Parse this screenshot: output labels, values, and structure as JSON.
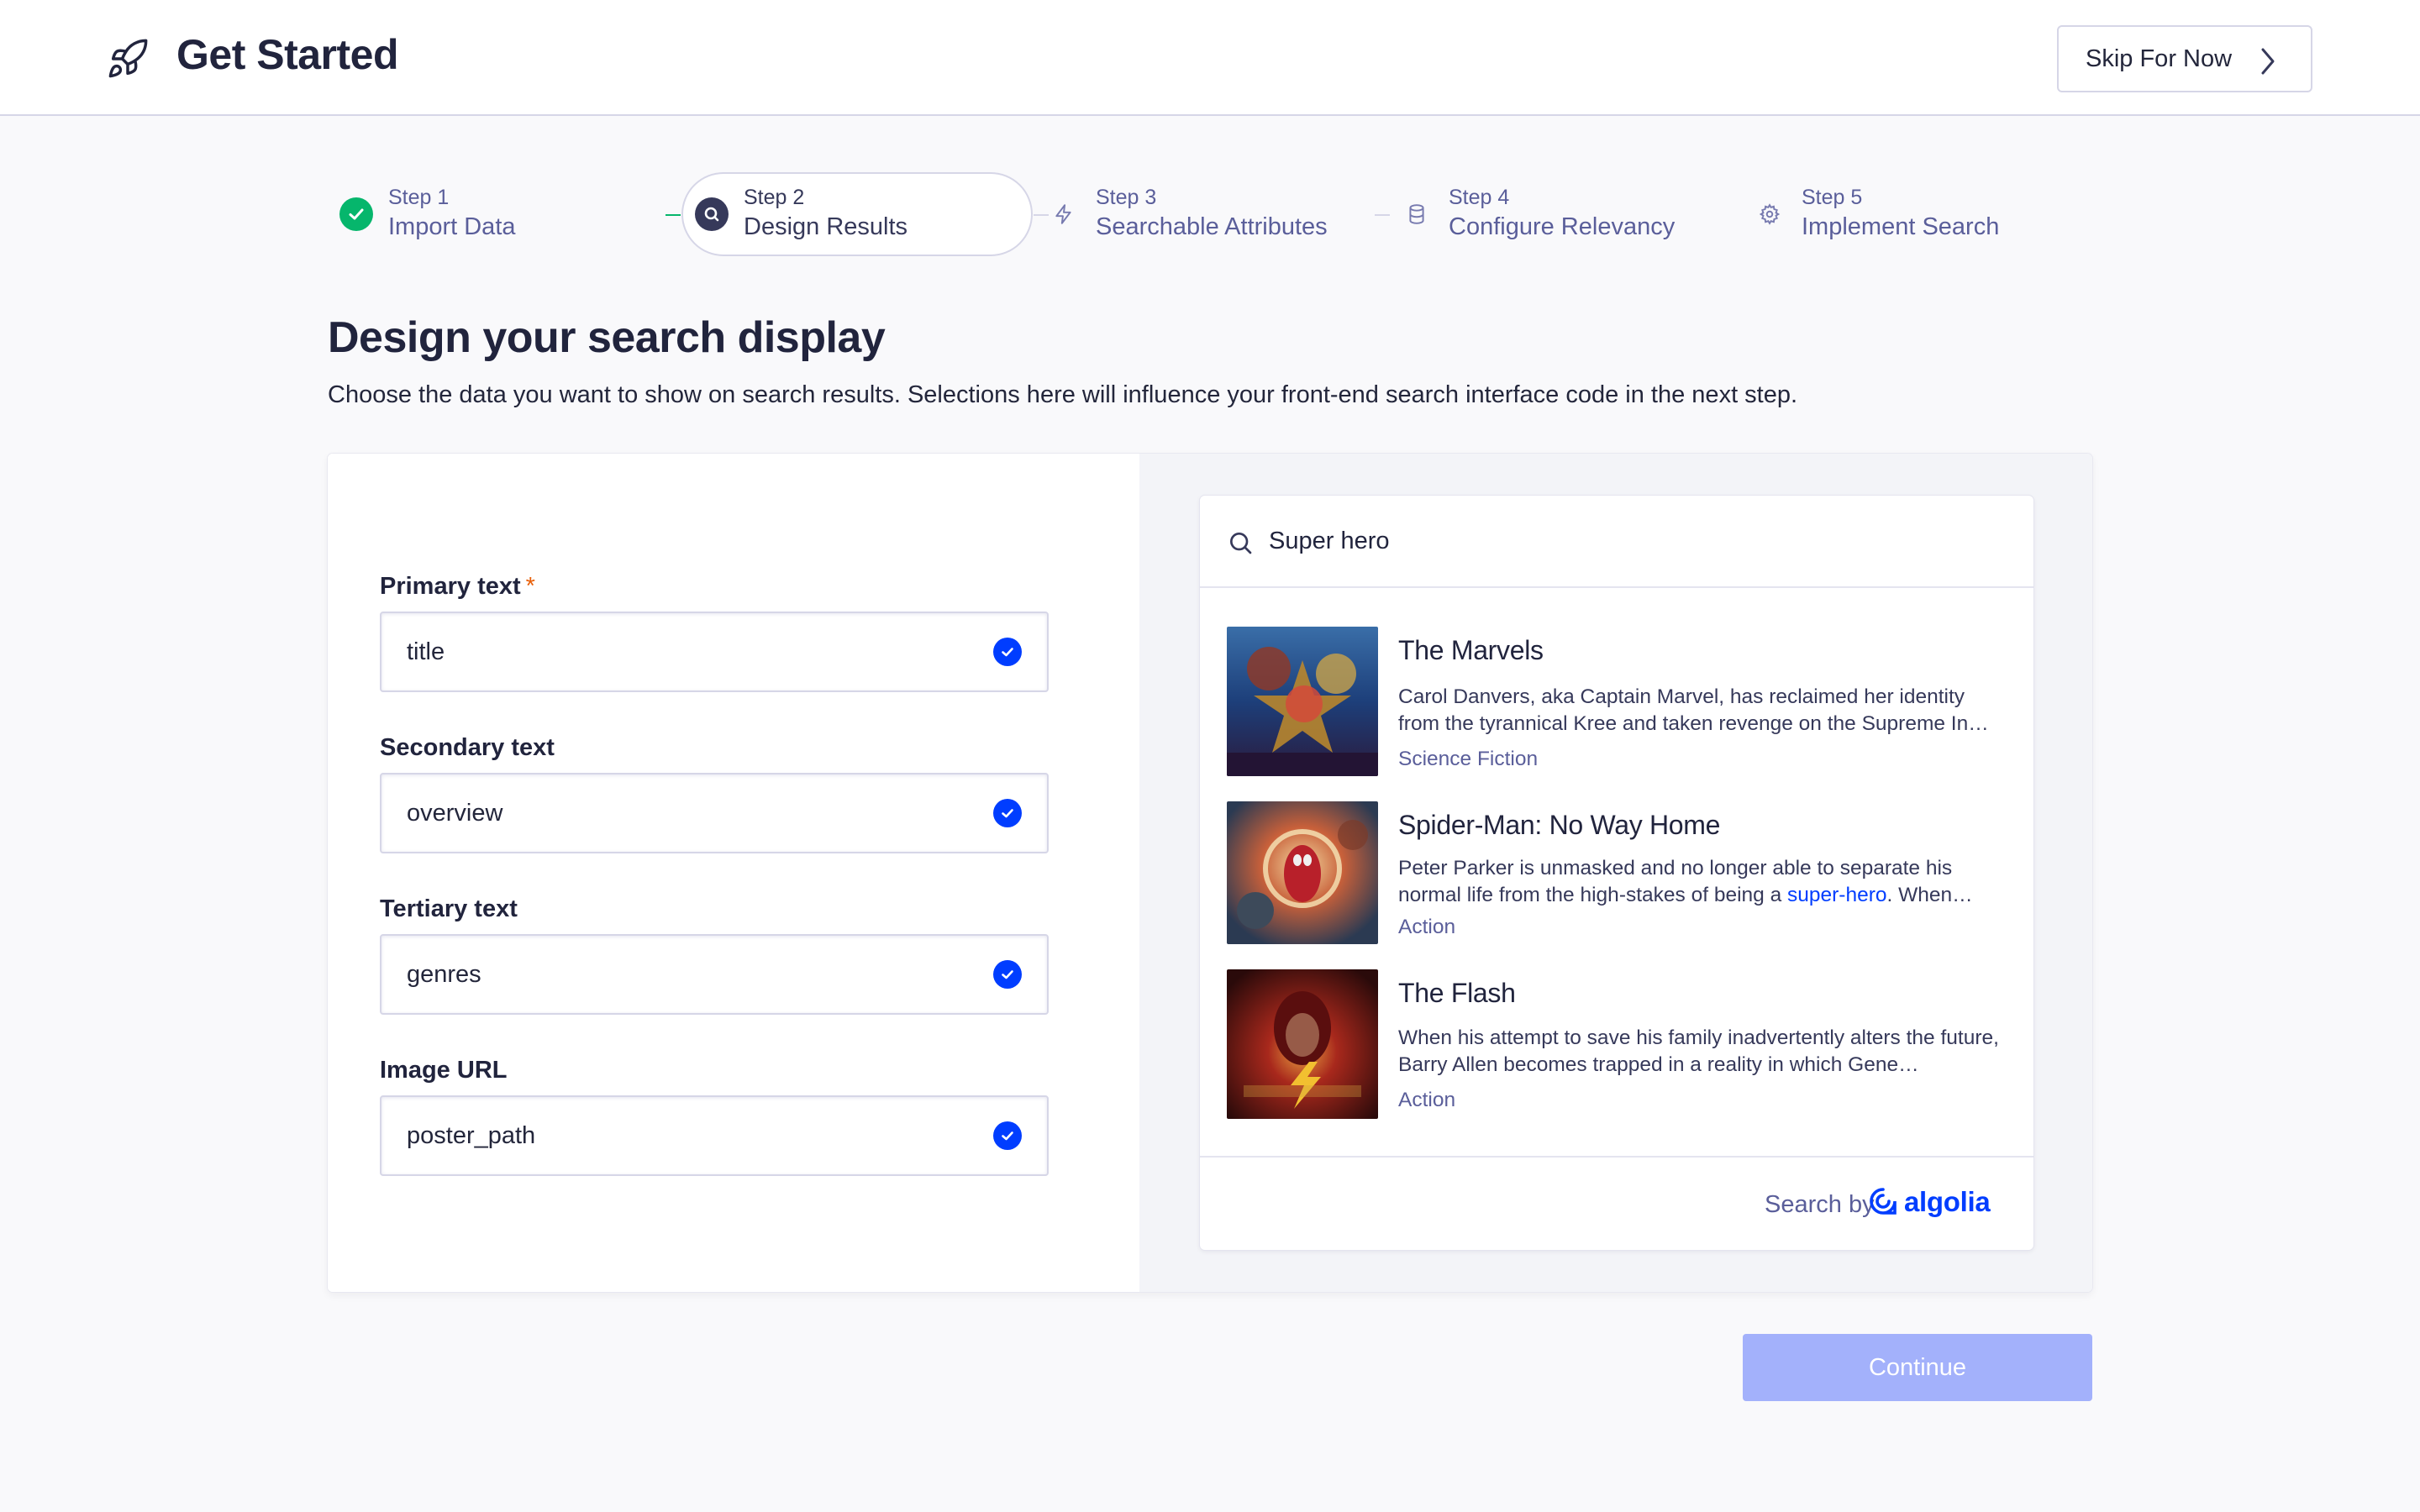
{
  "header": {
    "title": "Get Started",
    "skip_label": "Skip For Now"
  },
  "stepper": [
    {
      "num": "Step 1",
      "name": "Import Data",
      "status": "complete",
      "icon": "check-icon"
    },
    {
      "num": "Step 2",
      "name": "Design Results",
      "status": "active",
      "icon": "search-icon"
    },
    {
      "num": "Step 3",
      "name": "Searchable Attributes",
      "status": "upcoming",
      "icon": "lightning-icon"
    },
    {
      "num": "Step 4",
      "name": "Configure Relevancy",
      "status": "upcoming",
      "icon": "database-icon"
    },
    {
      "num": "Step 5",
      "name": "Implement Search",
      "status": "upcoming",
      "icon": "gear-icon"
    }
  ],
  "intro": {
    "heading": "Design your search display",
    "description": "Choose the data you want to show on search results. Selections here will influence your front-end search interface code in the next step."
  },
  "fields": [
    {
      "label": "Primary text",
      "required_mark": "*",
      "value": "title"
    },
    {
      "label": "Secondary text",
      "value": "overview"
    },
    {
      "label": "Tertiary text",
      "value": "genres"
    },
    {
      "label": "Image URL",
      "value": "poster_path"
    }
  ],
  "preview": {
    "query": "Super hero",
    "hits": [
      {
        "title": "The Marvels",
        "desc": "Carol Danvers, aka Captain Marvel, has reclaimed her identity from the tyrannical Kree and taken revenge on the Supreme In…",
        "genre": "Science Fiction"
      },
      {
        "title": "Spider-Man: No Way Home",
        "desc_before": "Peter Parker is unmasked and no longer able to separate his normal life from the high-stakes of being a ",
        "desc_highlight": "super-hero",
        "desc_after": ". When…",
        "genre": "Action"
      },
      {
        "title": "The Flash",
        "desc": "When his attempt to save his family inadvertently alters the future, Barry Allen becomes trapped in a reality in which Gene…",
        "genre": "Action"
      }
    ],
    "search_by": "Search by",
    "brand": "algolia"
  },
  "continue_label": "Continue",
  "colors": {
    "accent": "#003dff",
    "success": "#06b66c",
    "continue_disabled": "#a3b1fb"
  }
}
